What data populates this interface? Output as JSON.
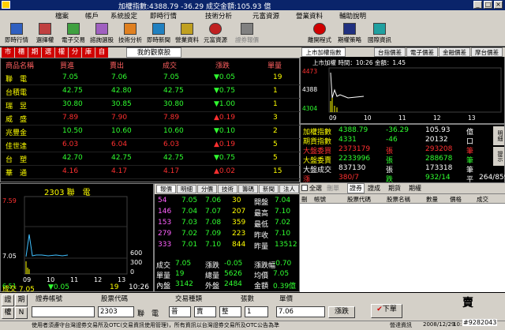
{
  "titlebar": {
    "text": "加權指數:4388.79  -36.29  成交金額:105.93  億",
    "controls": [
      "_",
      "□",
      "×"
    ]
  },
  "menu": [
    "檔案",
    "帳戶",
    "系統設定",
    "即時行情",
    "技術分析",
    "元富資源",
    "營業資料",
    "輔助說明"
  ],
  "toolbar": [
    "即時行情",
    "選擇權",
    "電子交易",
    "諮詢選股",
    "技術分析",
    "即時新聞",
    "營業資料",
    "元富資源",
    "證券報價",
    "離開程式",
    "期權策略",
    "國際資訊"
  ],
  "tabs": [
    "市",
    "櫃",
    "期",
    "選",
    "權",
    "分",
    "庫",
    "自",
    "我的觀察股"
  ],
  "table": {
    "headers": [
      "商品名稱",
      "買進",
      "賣出",
      "成交",
      "漲跌",
      "單量"
    ],
    "rows": [
      [
        "聯　電",
        "7.05",
        "7.06",
        "7.05",
        "▼0.05",
        "19"
      ],
      [
        "台積電",
        "42.75",
        "42.80",
        "42.75",
        "▼0.75",
        "1"
      ],
      [
        "瑞　昱",
        "30.80",
        "30.85",
        "30.80",
        "▼1.00",
        "1"
      ],
      [
        "威　盛",
        "7.89",
        "7.90",
        "7.89",
        "▲0.19",
        "3"
      ],
      [
        "兆豐金",
        "10.50",
        "10.60",
        "10.60",
        "▼0.10",
        "2"
      ],
      [
        "佳世達",
        "6.03",
        "6.04",
        "6.03",
        "▲0.19",
        "5"
      ],
      [
        "台　塑",
        "42.70",
        "42.75",
        "42.75",
        "▼0.75",
        "5"
      ],
      [
        "華　通",
        "4.16",
        "4.17",
        "4.17",
        "▲0.02",
        "15"
      ]
    ]
  },
  "chart": {
    "stock": "2303  聯　電",
    "y_labels": [
      "7.59",
      "7.05",
      "6.51"
    ],
    "vol_labels": [
      "600",
      "300",
      "0"
    ],
    "x_labels": [
      "09",
      "10",
      "11",
      "12",
      "13"
    ],
    "footer_label": "成交 7.05",
    "footer_chg": "▼0.05",
    "footer_vol": "19",
    "footer_time": "10:26"
  },
  "chart_data": {
    "type": "line",
    "x": [
      "09",
      "10",
      "11",
      "12",
      "13"
    ],
    "price_ylim": [
      6.51,
      7.59
    ],
    "volume_ylim": [
      0,
      600
    ]
  },
  "info": {
    "tabs": [
      "報價",
      "明細",
      "分價",
      "技術",
      "籌碼",
      "新聞",
      "法人"
    ],
    "book": [
      [
        "54",
        "7.05",
        "7.06",
        "30"
      ],
      [
        "146",
        "7.04",
        "7.07",
        "207"
      ],
      [
        "153",
        "7.03",
        "7.08",
        "359"
      ],
      [
        "279",
        "7.02",
        "7.09",
        "223"
      ],
      [
        "333",
        "7.01",
        "7.10",
        "844"
      ]
    ],
    "right_labels": [
      [
        "開盤",
        "7.04"
      ],
      [
        "最高",
        "7.10"
      ],
      [
        "最低",
        "7.02"
      ],
      [
        "昨收",
        "7.10"
      ],
      [
        "昨量",
        "13512"
      ]
    ],
    "stats": [
      [
        "成交",
        "7.05"
      ],
      [
        "漲跌",
        "-0.05"
      ],
      [
        "漲跌幅",
        "-0.70"
      ],
      [
        "單量",
        "19"
      ],
      [
        "總量",
        "5626"
      ],
      [
        "均價",
        "7.05"
      ],
      [
        "內盤",
        "3142"
      ],
      [
        "外盤",
        "2484"
      ],
      [
        "金額",
        "0.39億"
      ]
    ]
  },
  "right_top": {
    "dropdown": "上市加權指數",
    "tabs": [
      "台指價差",
      "電子價差",
      "金融價差",
      "摩台價差"
    ],
    "header": "上市加權  時間：10:26  金額：1.45",
    "y_labels": [
      "4473",
      "4388",
      "4304"
    ],
    "x_labels": [
      "09",
      "10",
      "11",
      "12",
      "13"
    ]
  },
  "summary": {
    "rows": [
      [
        "加權指數",
        "4388.79",
        "-36.29",
        "105.93",
        "億"
      ],
      [
        "期貨指數",
        "4331",
        "-46",
        "20132",
        "口"
      ],
      [
        "大盤委買",
        "2373179",
        "張",
        "293208",
        "筆"
      ],
      [
        "大盤委賣",
        "2233996",
        "張",
        "288678",
        "筆"
      ],
      [
        "大盤成交",
        "837130",
        "張",
        "173318",
        "筆"
      ],
      [
        "漲",
        "380/7",
        "跌",
        "932/14",
        "平",
        "264/859"
      ]
    ],
    "side_tabs": [
      "明細",
      "提示"
    ]
  },
  "orders": {
    "toolbar": [
      "全選",
      "刪單",
      "證券",
      "證成",
      "期貨",
      "期權"
    ],
    "headers": [
      "刪",
      "帳號",
      "股票代碼",
      "股票名稱",
      "數量",
      "價格",
      "成交"
    ]
  },
  "order_form": {
    "left_buttons": [
      "證",
      "期",
      "權",
      "N"
    ],
    "labels": [
      "證券帳號",
      "股票代碼",
      "交易種類",
      "張數",
      "單價"
    ],
    "stock_code": "2303",
    "stock_name": "聯　電",
    "trade_type": [
      "普",
      "賣",
      "整"
    ],
    "qty": "1",
    "price": "7.06",
    "limit_btn": "漲跌",
    "submit": "下單",
    "side": "賣"
  },
  "status": {
    "text": "使用者須遵守台灣證券交易所及OTC(交易資訊使用管理)，所有資訊以台灣證券交易所及OTC公告為準",
    "company": "營達資訊",
    "date": "2008/12/29",
    "time": "10:26",
    "watermark": "#9282043"
  }
}
